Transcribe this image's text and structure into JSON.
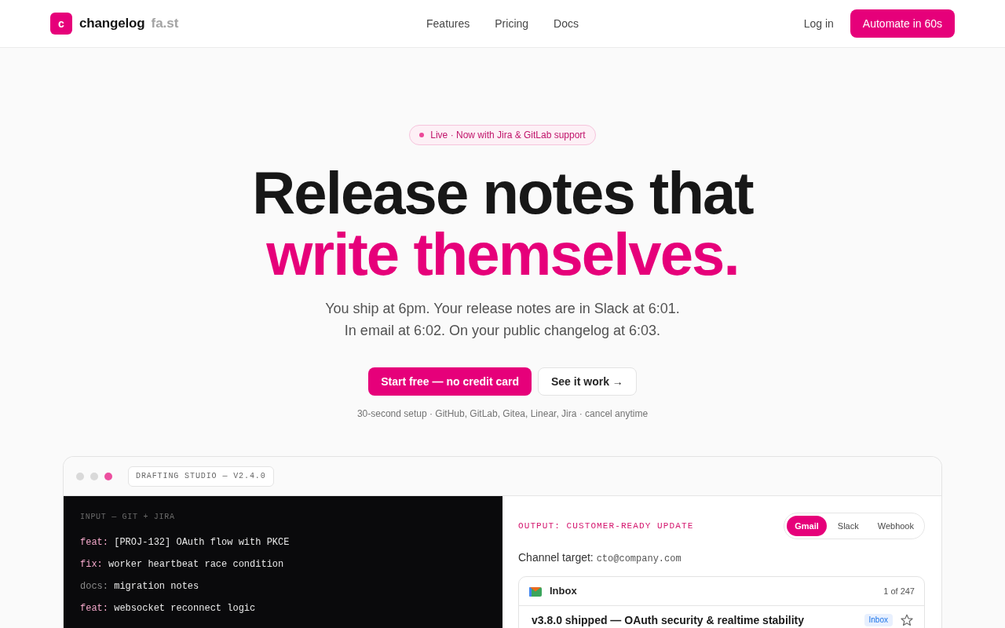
{
  "header": {
    "logo_letter": "c",
    "brand": "changelog",
    "domain": "fa.st",
    "nav": [
      "Features",
      "Pricing",
      "Docs"
    ],
    "login": "Log in",
    "cta": "Automate in 60s"
  },
  "hero": {
    "announcement": "Live · Now with Jira & GitLab support",
    "headline": "Release notes that",
    "headline_accent": "write themselves.",
    "subtitle": [
      "You ship at 6pm. Your release notes are in Slack at 6:01.",
      "In email at 6:02. On your public changelog at 6:03."
    ],
    "primary_button": "Start free — no credit card",
    "secondary_button": "See it work →",
    "note": "30-second setup · GitHub, GitLab, Gitea, Linear, Jira · cancel anytime"
  },
  "studio": {
    "title": "DRAFTING STUDIO — V2.4.0",
    "input": {
      "label": "INPUT — GIT + JIRA",
      "commits": [
        {
          "kind": "feat",
          "prefix": "feat:",
          "text": "[PROJ-132] OAuth flow with PKCE"
        },
        {
          "kind": "fix",
          "prefix": "fix:",
          "text": "worker heartbeat race condition"
        },
        {
          "kind": "docs",
          "prefix": "docs:",
          "text": "migration notes"
        },
        {
          "kind": "feat",
          "prefix": "feat:",
          "text": "websocket reconnect logic"
        }
      ]
    },
    "output": {
      "label": "OUTPUT: CUSTOMER-READY UPDATE",
      "channels": [
        {
          "label": "Gmail",
          "selected": true
        },
        {
          "label": "Slack",
          "selected": false
        },
        {
          "label": "Webhook",
          "selected": false
        }
      ],
      "target_label": "Channel target:",
      "target": "cto@company.com",
      "inbox": {
        "title": "Inbox",
        "count": "1 of 247",
        "messages": [
          {
            "subject": "v3.8.0 shipped — OAuth security & realtime stability",
            "tag": "Inbox",
            "starred": false
          }
        ]
      }
    }
  }
}
